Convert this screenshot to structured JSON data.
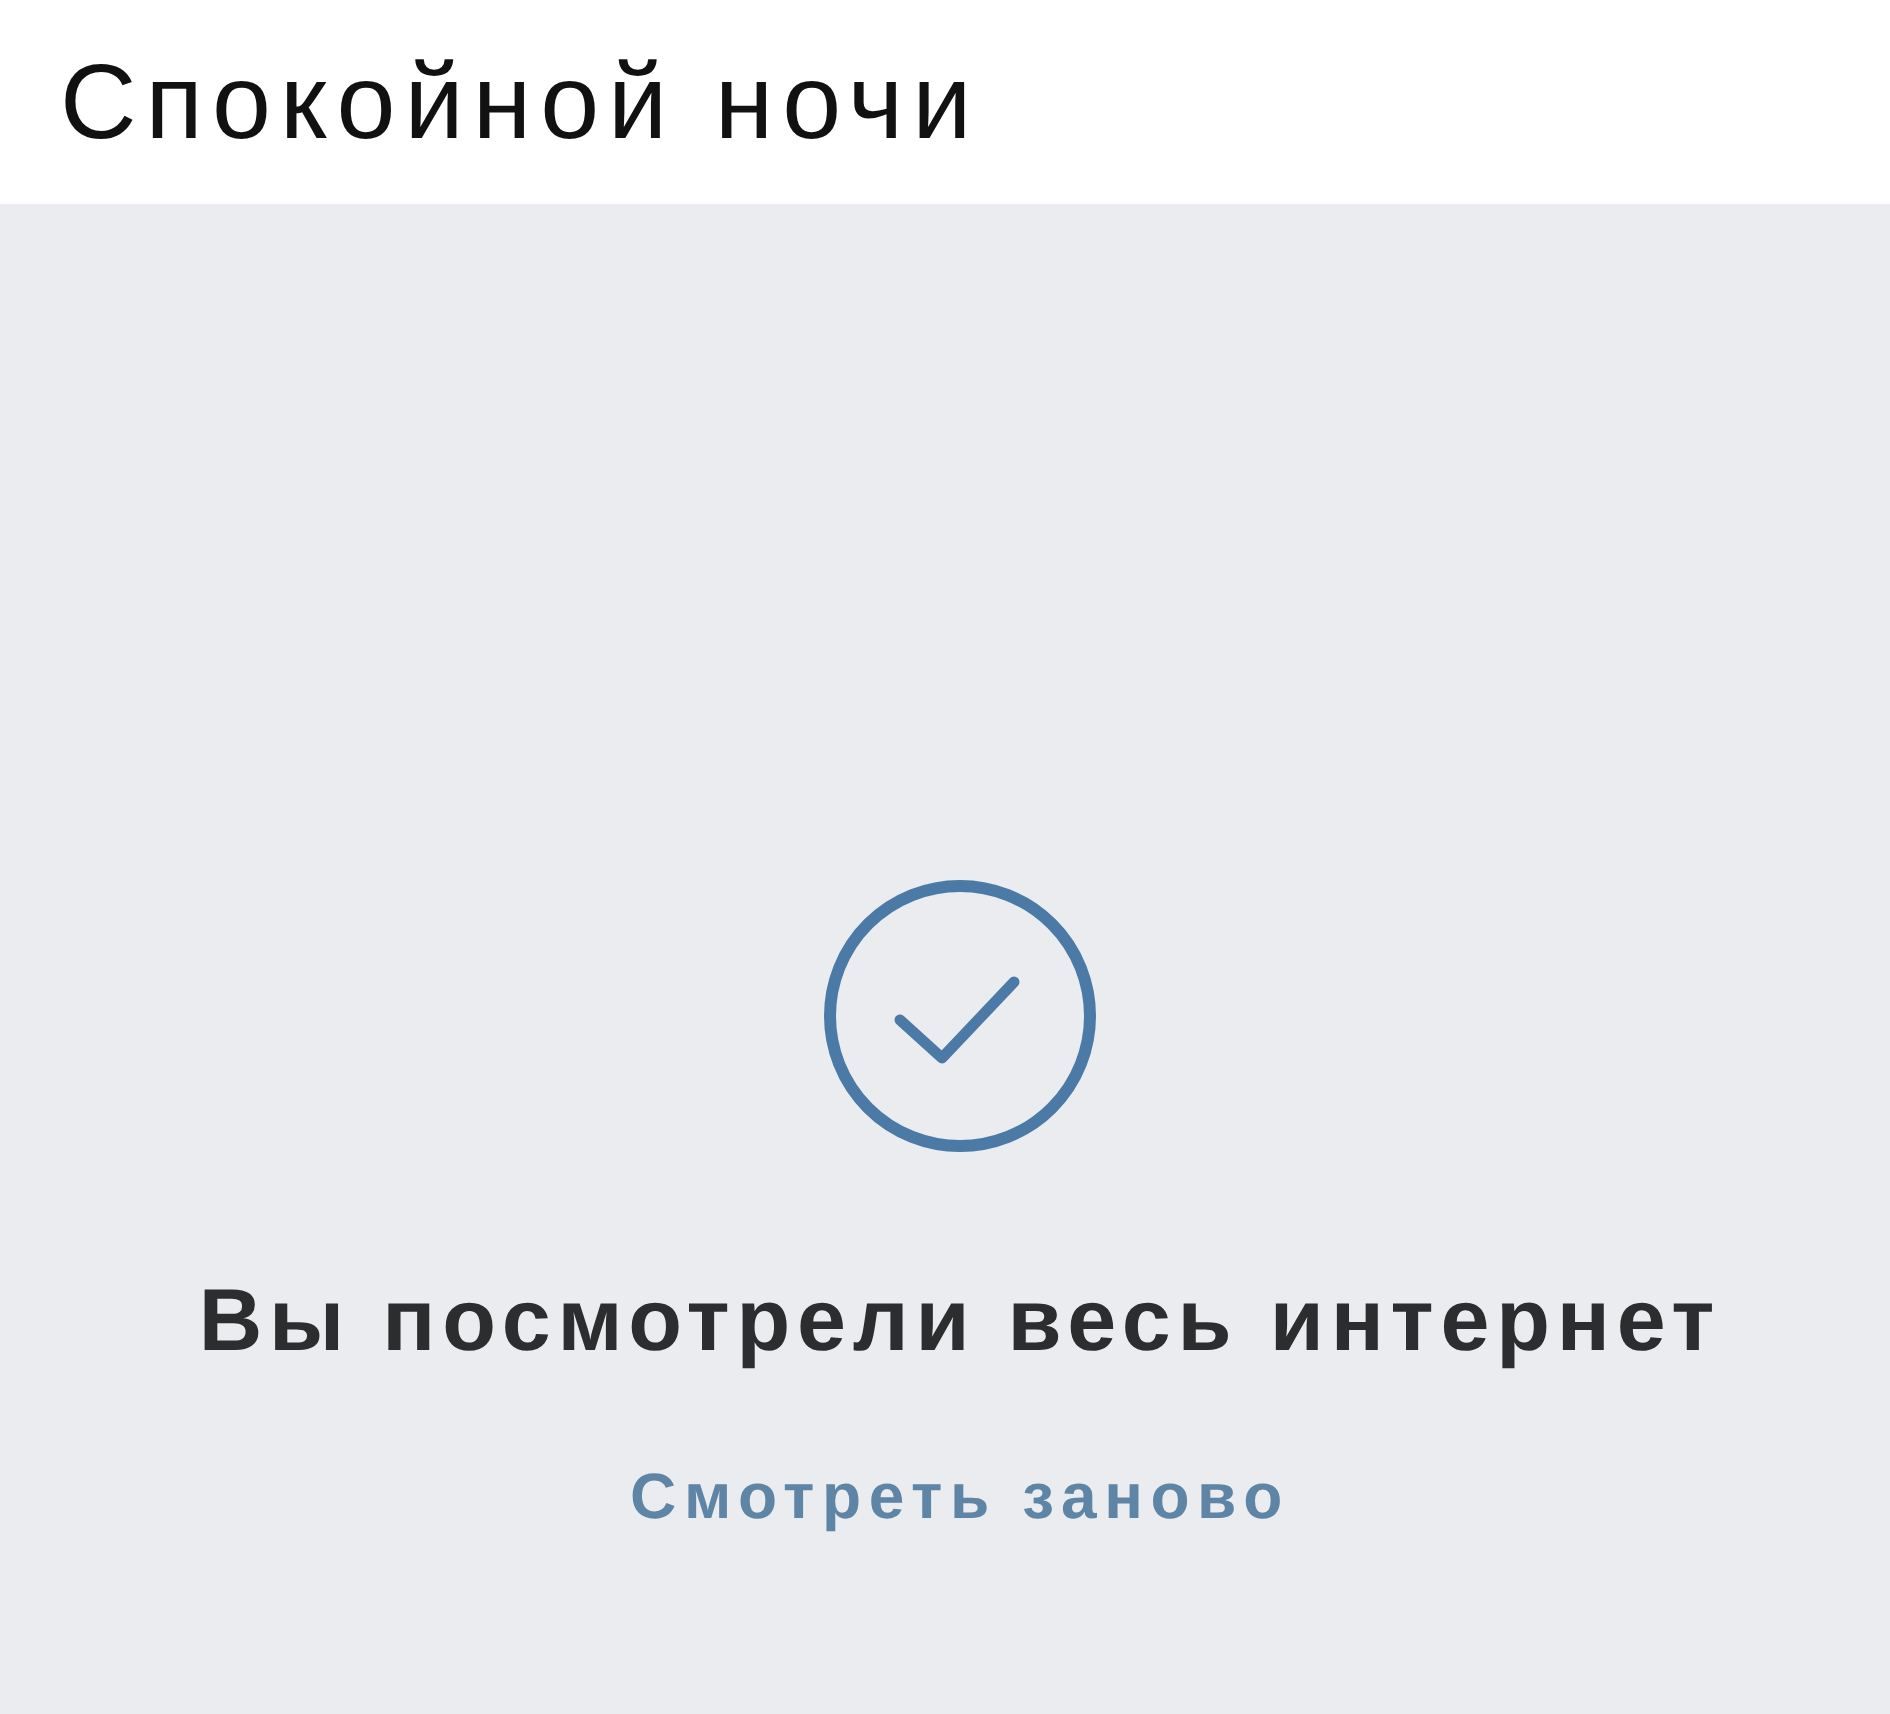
{
  "caption": {
    "text": "Спокойной ночи"
  },
  "feed_end": {
    "title": "Вы посмотрели весь интернет",
    "action": "Смотреть заново"
  }
}
